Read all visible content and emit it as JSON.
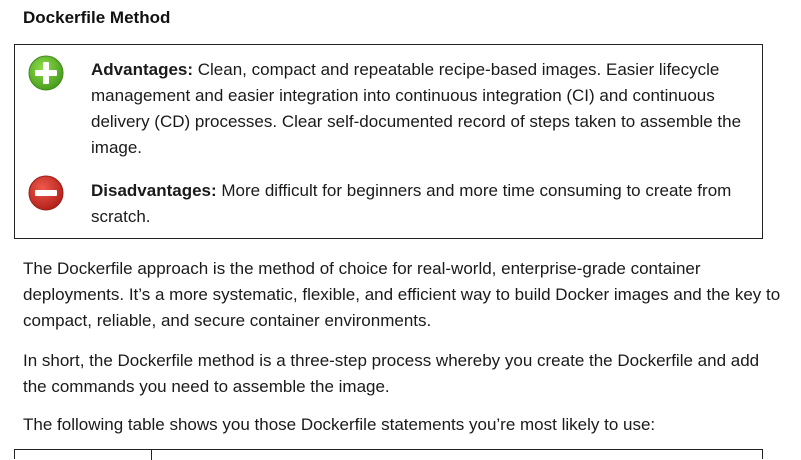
{
  "heading": "Dockerfile Method",
  "callout": {
    "advantages": {
      "label": "Advantages:",
      "text": " Clean, compact and repeatable recipe-based images. Easier lifecycle management and easier integration into continuous integration (CI) and continuous delivery (CD) processes. Clear self-documented record of steps taken to assemble the image.",
      "icon": "plus-circle-icon",
      "color": "#5cb52a"
    },
    "disadvantages": {
      "label": "Disadvantages:",
      "text": " More difficult for beginners and more time consuming to create from scratch.",
      "icon": "minus-circle-icon",
      "color": "#d4302a"
    }
  },
  "paragraphs": [
    "The Dockerfile approach is the method of choice for real-world, enterprise-grade container deployments. It’s a more systematic, flexible, and efficient way to build Docker images and the key to compact, reliable, and secure container environments.",
    "In short, the Dockerfile method is a three-step process whereby you create the Dockerfile and add the commands you need to assemble the image.",
    "The following table shows you those Dockerfile statements you’re most likely to use:"
  ]
}
